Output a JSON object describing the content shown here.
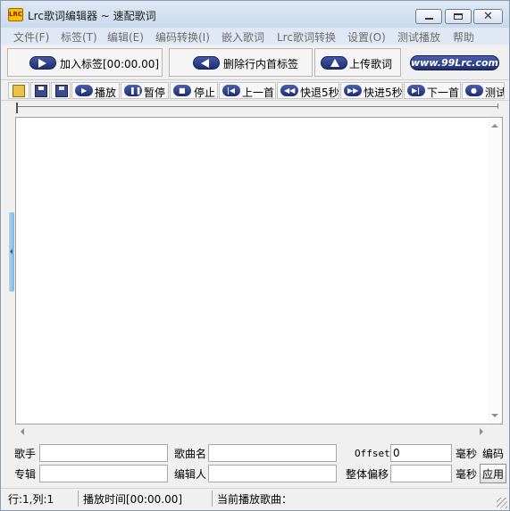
{
  "window": {
    "icon_label": "LRC",
    "title": "Lrc歌词编辑器 ~ 速配歌词"
  },
  "menu": [
    "文件(F)",
    "标签(T)",
    "编辑(E)",
    "编码转换(I)",
    "嵌入歌词",
    "Lrc歌词转换",
    "设置(O)",
    "测试播放",
    "帮助"
  ],
  "top_buttons": {
    "add_tag": "加入标签[00:00.00]",
    "delete_tag": "删除行内首标签",
    "upload": "上传歌词",
    "site": "www.99Lrc.com"
  },
  "toolbar": {
    "play": "播放",
    "pause": "暂停",
    "stop": "停止",
    "prev": "上一首",
    "rewind": "快退5秒",
    "forward": "快进5秒",
    "next": "下一首",
    "test": "测试"
  },
  "editor": {
    "content": ""
  },
  "form": {
    "singer_label": "歌手",
    "singer_value": "",
    "song_label": "歌曲名",
    "song_value": "",
    "offset_label": "Offset",
    "offset_value": "0",
    "offset_unit": "毫秒",
    "encoding_label": "编码",
    "album_label": "专辑",
    "album_value": "",
    "editor_label": "编辑人",
    "editor_value": "",
    "shift_label": "整体偏移",
    "shift_value": "",
    "shift_unit": "毫秒",
    "apply_label": "应用"
  },
  "status": {
    "position": "行:1,列:1",
    "play_time": "播放时间[00:00.00]",
    "current_song": "当前播放歌曲："
  }
}
